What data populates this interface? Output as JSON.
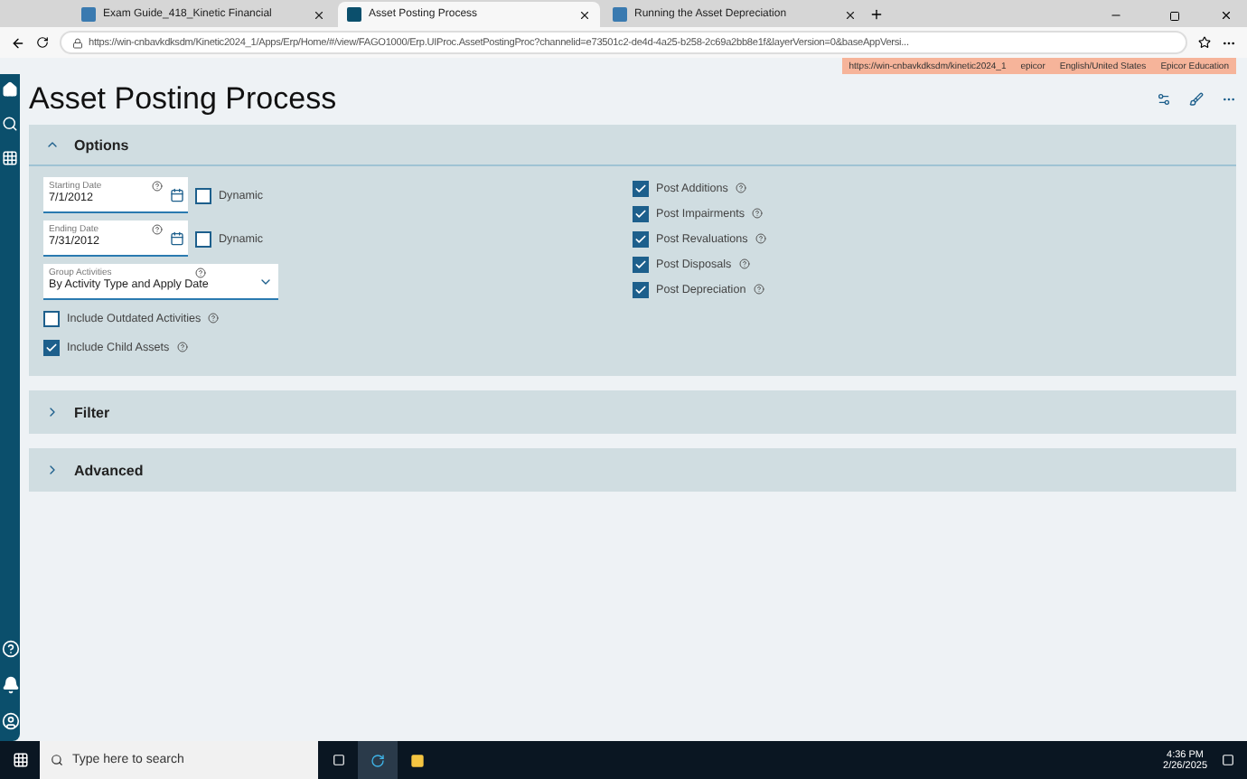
{
  "browser": {
    "tabs": [
      {
        "label": "Exam Guide_418_Kinetic Financial",
        "selected": false
      },
      {
        "label": "Asset Posting Process",
        "selected": true
      },
      {
        "label": "Running the Asset Depreciation",
        "selected": false
      }
    ],
    "url": "https://win-cnbavkdksdm/Kinetic2024_1/Apps/Erp/Home/#/view/FAGO1000/Erp.UIProc.AssetPostingProc?channelid=e73501c2-de4d-4a25-b258-2c69a2bb8e1f&layerVersion=0&baseAppVersi..."
  },
  "env_bar": [
    "https://win-cnbavkdksdm/kinetic2024_1",
    "epicor",
    "English/United States",
    "Epicor Education"
  ],
  "page": {
    "title": "Asset Posting Process"
  },
  "sections": [
    {
      "title": "Options",
      "expanded": true
    },
    {
      "title": "Filter",
      "expanded": false
    },
    {
      "title": "Advanced",
      "expanded": false
    }
  ],
  "options": {
    "date_fields": [
      {
        "label": "Starting Date",
        "value": "7/1/2012",
        "dynamic_label": "Dynamic",
        "dynamic": false
      },
      {
        "label": "Ending Date",
        "value": "7/31/2012",
        "dynamic_label": "Dynamic",
        "dynamic": false
      }
    ],
    "group": {
      "label": "Group Activities",
      "value": "By Activity Type and Apply Date"
    },
    "left_checks": [
      {
        "label": "Include Outdated Activities",
        "checked": false
      },
      {
        "label": "Include Child Assets",
        "checked": true
      }
    ],
    "right_checks": [
      {
        "label": "Post Additions",
        "checked": true
      },
      {
        "label": "Post Impairments",
        "checked": true
      },
      {
        "label": "Post Revaluations",
        "checked": true
      },
      {
        "label": "Post Disposals",
        "checked": true
      },
      {
        "label": "Post Depreciation",
        "checked": true
      }
    ]
  },
  "taskbar": {
    "search_placeholder": "Type here to search",
    "time": "4:36 PM",
    "date": "2/26/2025"
  }
}
